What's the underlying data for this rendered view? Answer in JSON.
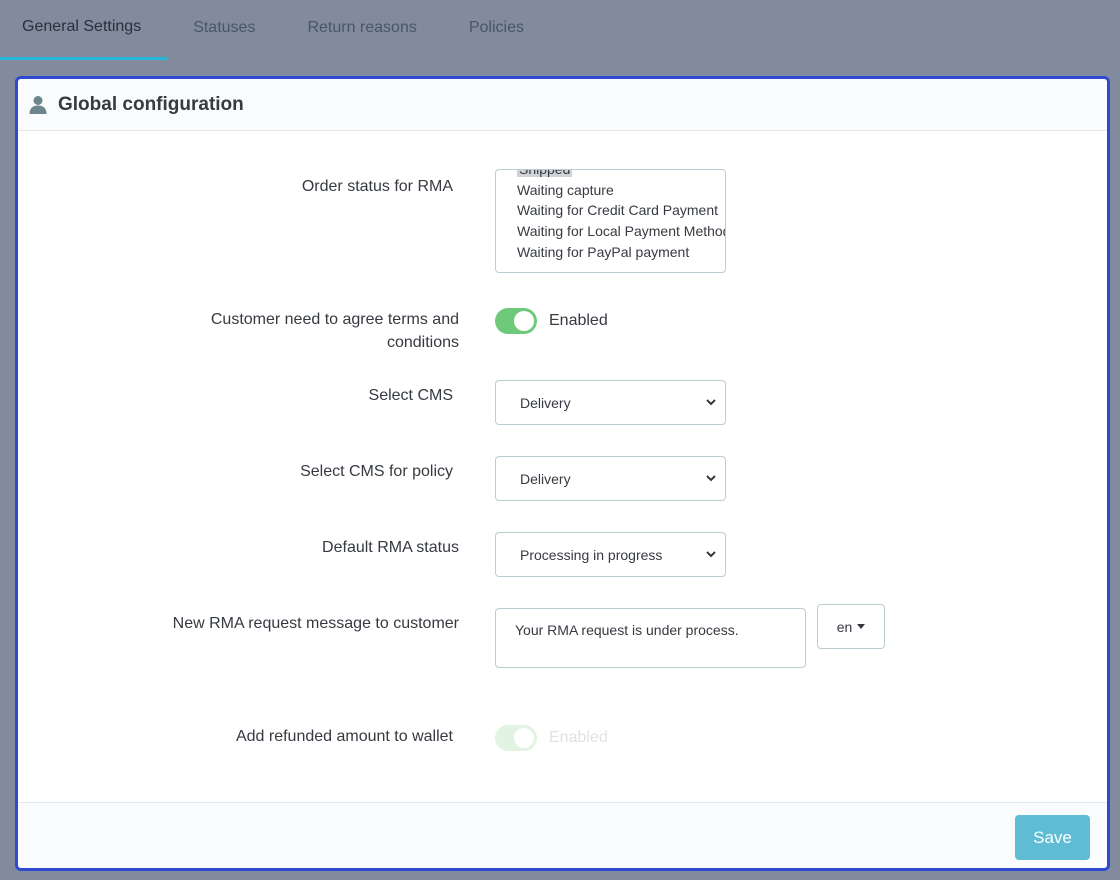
{
  "tabs": [
    {
      "label": "General Settings",
      "active": true
    },
    {
      "label": "Statuses",
      "active": false
    },
    {
      "label": "Return reasons",
      "active": false
    },
    {
      "label": "Policies",
      "active": false
    }
  ],
  "panel": {
    "title": "Global configuration",
    "icon": "user-icon"
  },
  "form": {
    "order_status": {
      "label": "Order status for RMA",
      "options": [
        "Shipped",
        "Waiting capture",
        "Waiting for Credit Card Payment",
        "Waiting for Local Payment Method",
        "Waiting for PayPal payment"
      ]
    },
    "agree_terms": {
      "label_line1": "Customer need to agree terms and",
      "label_line2": "conditions",
      "state": "Enabled"
    },
    "select_cms": {
      "label": "Select CMS",
      "value": "Delivery"
    },
    "select_cms_policy": {
      "label": "Select CMS for policy",
      "value": "Delivery"
    },
    "default_rma_status": {
      "label": "Default RMA status",
      "value": "Processing in progress"
    },
    "new_rma_message": {
      "label": "New RMA request message to customer",
      "value": "Your RMA request is under process.",
      "language": "en"
    },
    "refund_wallet": {
      "label": "Add refunded amount to wallet",
      "state": "Enabled"
    }
  },
  "footer": {
    "save_label": "Save"
  },
  "colors": {
    "accent": "#25b9d7",
    "toggle_on": "#6ec97a",
    "save_button": "#5ebcd5",
    "panel_border": "#2f49d1"
  }
}
